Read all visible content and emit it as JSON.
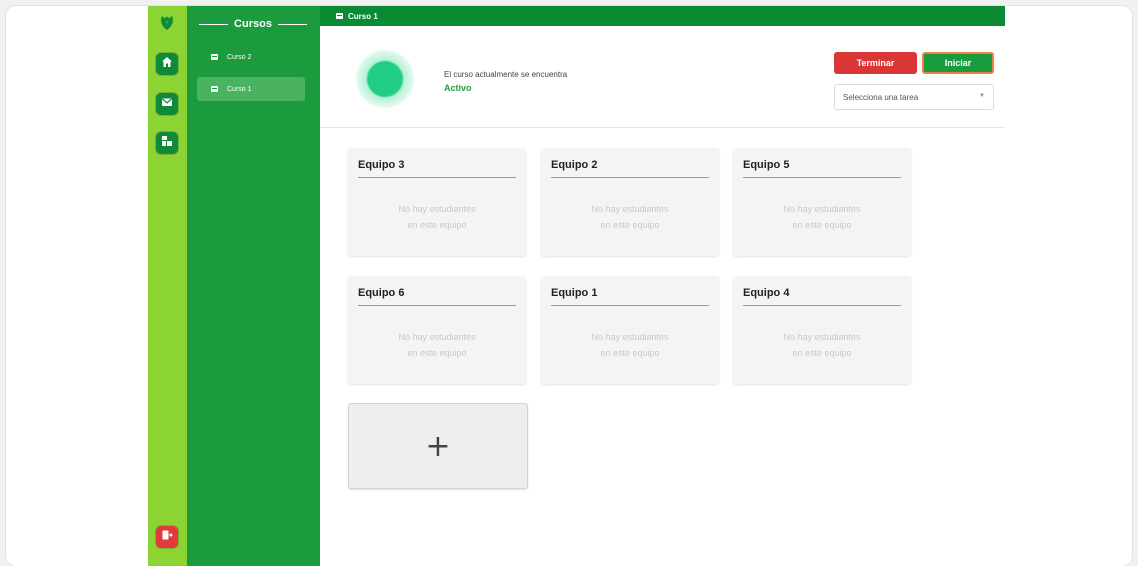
{
  "topbar": {
    "course_label": "Curso 1"
  },
  "courses_panel": {
    "heading": "Cursos",
    "items": [
      {
        "label": "Curso 2",
        "active": false
      },
      {
        "label": "Curso 1",
        "active": true
      }
    ]
  },
  "header": {
    "status_text": "El curso actualmente se encuentra",
    "status_value": "Activo",
    "end_button": "Terminar",
    "start_button": "Iniciar",
    "task_select_placeholder": "Selecciona una tarea",
    "select_arrow": "▼"
  },
  "teams": [
    {
      "name": "Equipo 3",
      "empty_line1": "No hay estudiantes",
      "empty_line2": "en este equipo"
    },
    {
      "name": "Equipo 2",
      "empty_line1": "No hay estudiantes",
      "empty_line2": "en este equipo"
    },
    {
      "name": "Equipo 5",
      "empty_line1": "No hay estudiantes",
      "empty_line2": "en este equipo"
    },
    {
      "name": "Equipo 6",
      "empty_line1": "No hay estudiantes",
      "empty_line2": "en este equipo"
    },
    {
      "name": "Equipo 1",
      "empty_line1": "No hay estudiantes",
      "empty_line2": "en este equipo"
    },
    {
      "name": "Equipo 4",
      "empty_line1": "No hay estudiantes",
      "empty_line2": "en este equipo"
    }
  ],
  "add_team": {
    "symbol": "+"
  },
  "icons": {
    "logo": "leaf-logo-icon",
    "home": "home-icon",
    "mail": "mail-icon",
    "groups": "groups-icon",
    "logout": "logout-icon"
  },
  "colors": {
    "rail": "#8cd433",
    "panel": "#1c9a3e",
    "topbar": "#0b8a35",
    "end_button": "#d93636",
    "start_button": "#1c9a3e",
    "status_active": "#21cc85"
  }
}
